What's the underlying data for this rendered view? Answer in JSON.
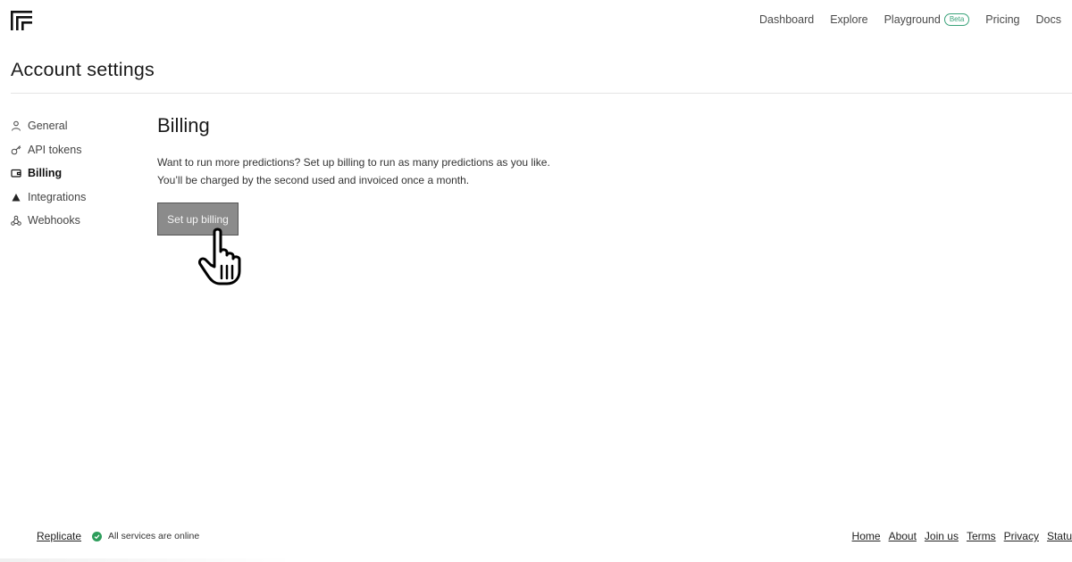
{
  "header": {
    "logo_icon": "replicate-logo-icon",
    "nav": [
      {
        "label": "Dashboard"
      },
      {
        "label": "Explore"
      },
      {
        "label": "Playground",
        "badge": "Beta"
      },
      {
        "label": "Pricing"
      },
      {
        "label": "Docs"
      }
    ]
  },
  "page": {
    "title": "Account settings"
  },
  "sidebar": {
    "items": [
      {
        "label": "General",
        "icon": "user-icon",
        "active": false
      },
      {
        "label": "API tokens",
        "icon": "key-icon",
        "active": false
      },
      {
        "label": "Billing",
        "icon": "wallet-icon",
        "active": true
      },
      {
        "label": "Integrations",
        "icon": "triangle-icon",
        "active": false
      },
      {
        "label": "Webhooks",
        "icon": "webhook-icon",
        "active": false
      }
    ]
  },
  "billing": {
    "title": "Billing",
    "line1": "Want to run more predictions? Set up billing to run as many predictions as you like.",
    "line2": "You’ll be charged by the second used and invoiced once a month.",
    "button_label": "Set up billing"
  },
  "footer": {
    "brand": "Replicate",
    "status_text": "All services are online",
    "status_color": "#2d9d5b",
    "links": [
      "Home",
      "About",
      "Join us",
      "Terms",
      "Privacy",
      "Status"
    ]
  },
  "colors": {
    "accent_beta": "#3aa37a",
    "button_bg": "#8b8b8b"
  },
  "cursor_icon": "hand-pointer-icon"
}
